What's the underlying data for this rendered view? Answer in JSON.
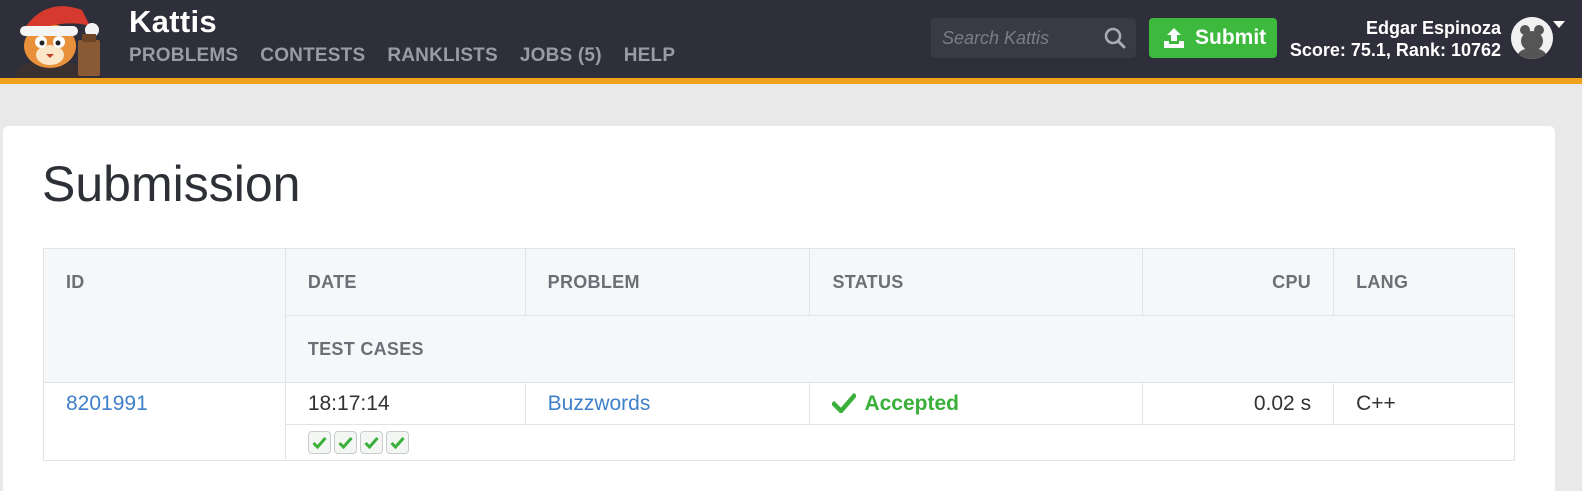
{
  "header": {
    "brand": "Kattis",
    "nav": [
      "PROBLEMS",
      "CONTESTS",
      "RANKLISTS",
      "JOBS (5)",
      "HELP"
    ],
    "search_placeholder": "Search Kattis",
    "submit_label": "Submit",
    "user_name": "Edgar Espinoza",
    "user_score": "Score: 75.1, Rank: 10762"
  },
  "colors": {
    "header_bg": "#2e2f3a",
    "accent": "#f0a21c",
    "submit_green": "#3dba3d",
    "link_blue": "#3f80c9",
    "accepted_green": "#3ab03a"
  },
  "icons": [
    "kattis-cat-santa-logo",
    "search-icon",
    "upload-icon",
    "avatar-icon",
    "chevron-down-icon",
    "check-icon"
  ],
  "page": {
    "title": "Submission"
  },
  "table": {
    "headers": {
      "id": "ID",
      "date": "DATE",
      "problem": "PROBLEM",
      "status": "STATUS",
      "cpu": "CPU",
      "lang": "LANG",
      "test_cases": "TEST CASES"
    },
    "row": {
      "id": "8201991",
      "date": "18:17:14",
      "problem": "Buzzwords",
      "status": "Accepted",
      "cpu": "0.02 s",
      "lang": "C++",
      "test_cases_passed": 4,
      "test_cases_total": 4
    }
  }
}
